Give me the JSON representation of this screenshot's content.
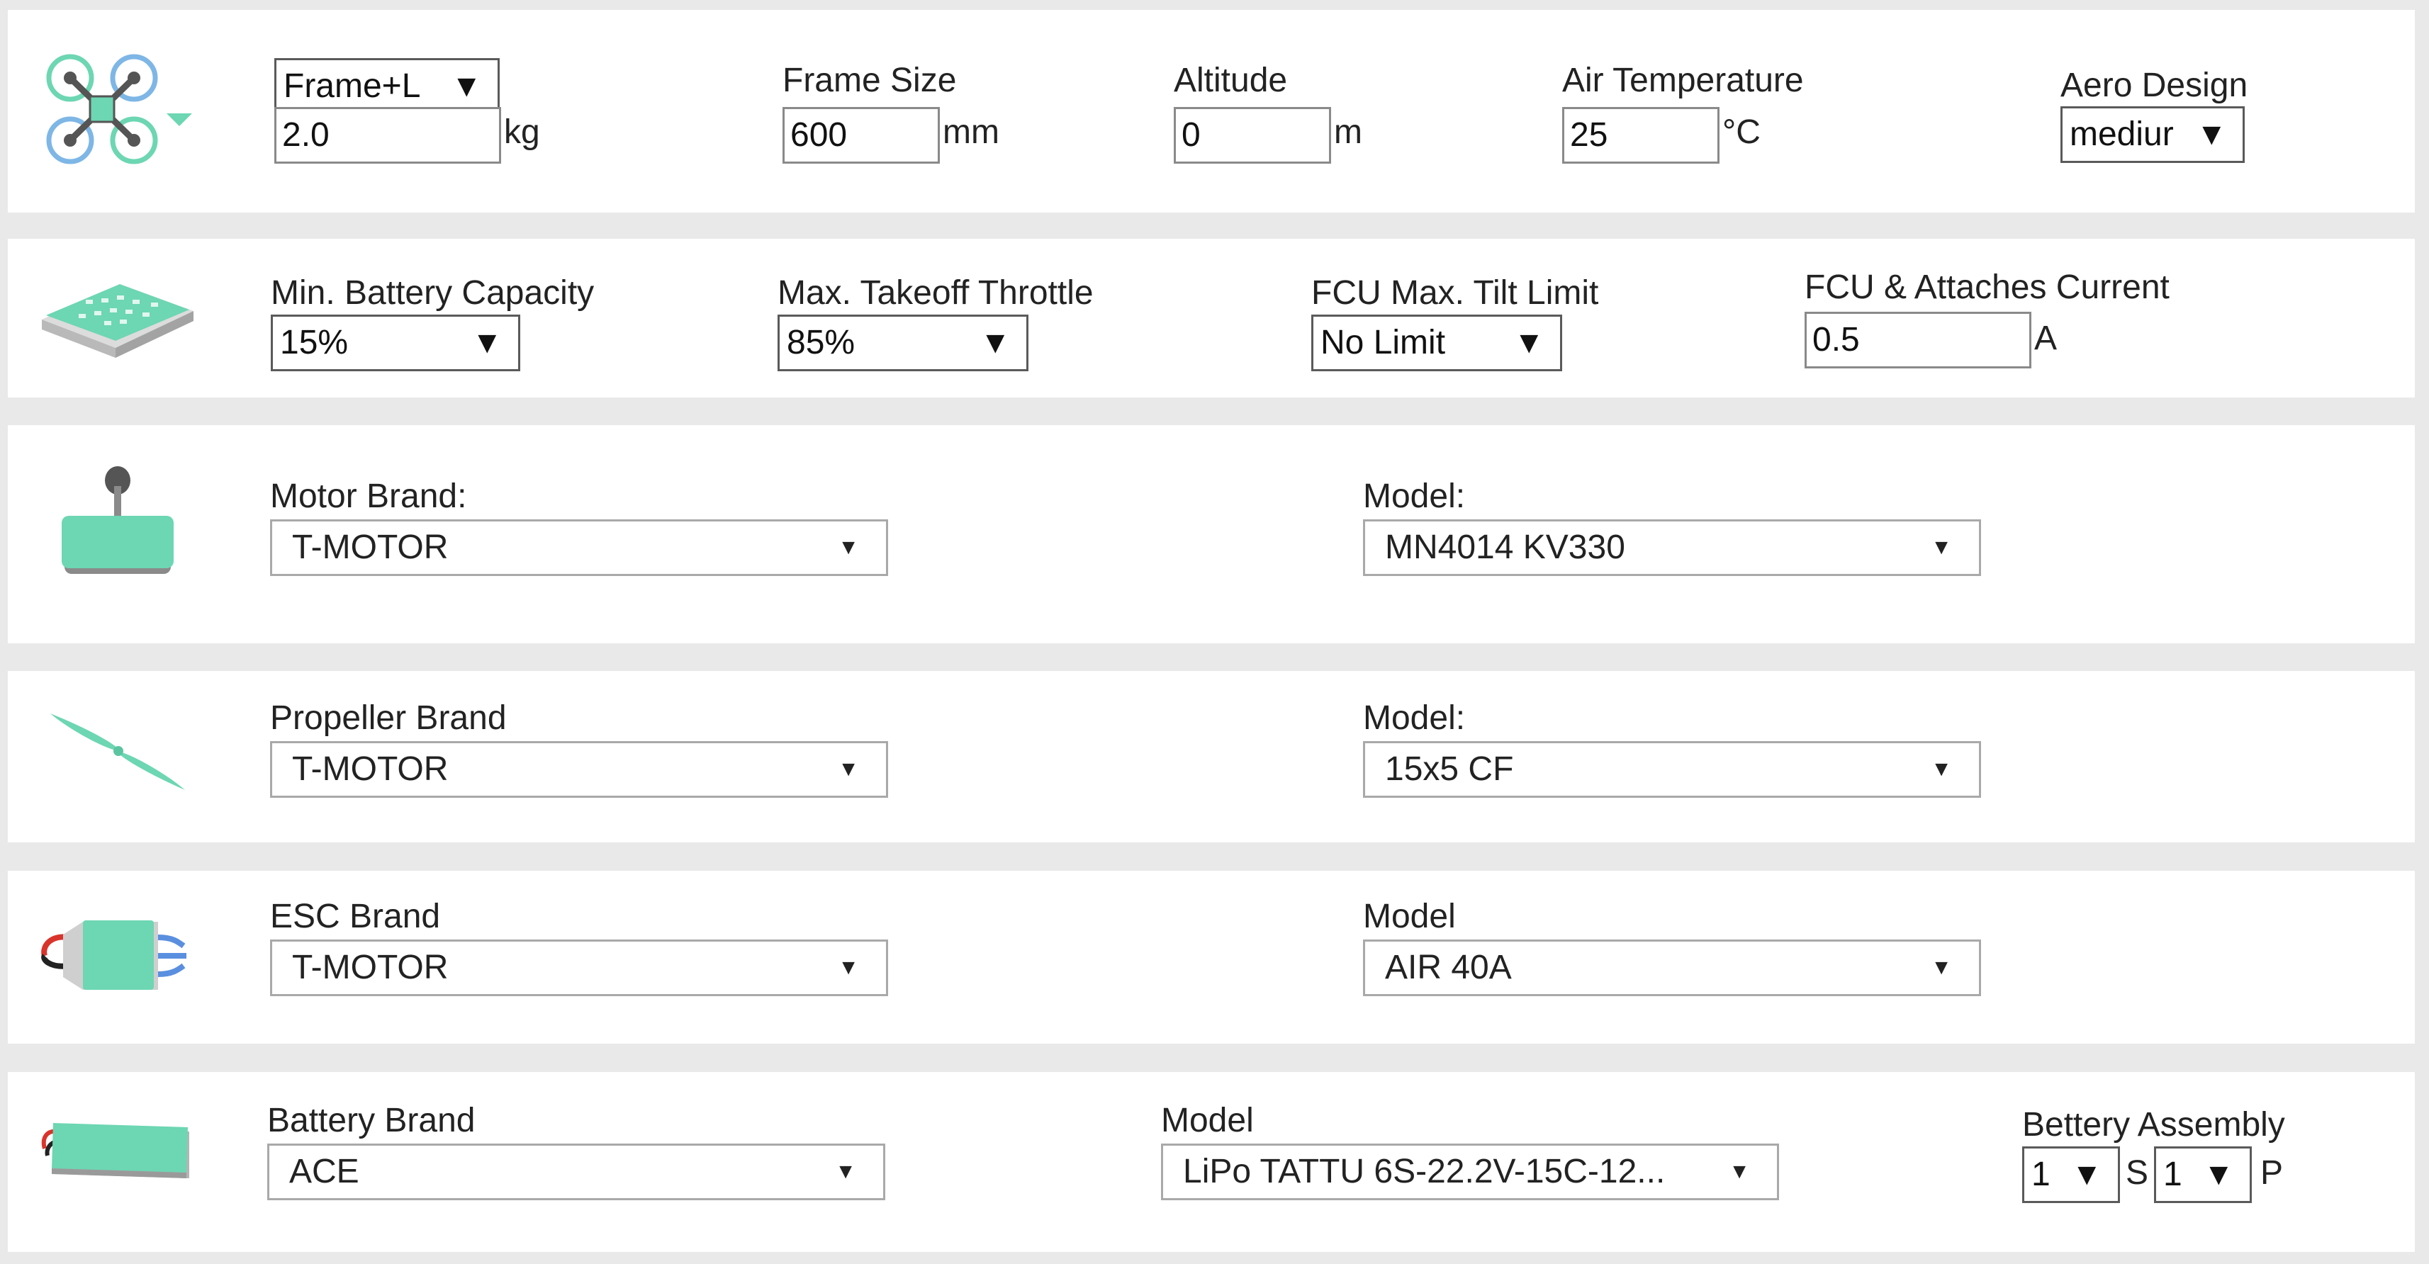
{
  "frame": {
    "icon": "quadcopter-frame-icon",
    "type_select": "Frame+L",
    "weight_value": "2.0",
    "weight_unit": "kg",
    "frame_size_label": "Frame Size",
    "frame_size_value": "600",
    "frame_size_unit": "mm",
    "altitude_label": "Altitude",
    "altitude_value": "0",
    "altitude_unit": "m",
    "air_temp_label": "Air Temperature",
    "air_temp_value": "25",
    "air_temp_unit": "°C",
    "aero_label": "Aero Design",
    "aero_select": "mediur"
  },
  "controller": {
    "icon": "flight-controller-icon",
    "min_battery_label": "Min. Battery Capacity",
    "min_battery_select": "15%",
    "max_throttle_label": "Max. Takeoff Throttle",
    "max_throttle_select": "85%",
    "tilt_label": "FCU Max. Tilt Limit",
    "tilt_select": "No Limit",
    "current_label": "FCU & Attaches Current",
    "current_value": "0.5",
    "current_unit": "A"
  },
  "motor": {
    "icon": "motor-icon",
    "brand_label": "Motor Brand:",
    "brand_select": "T-MOTOR",
    "model_label": "Model:",
    "model_select": "MN4014 KV330"
  },
  "propeller": {
    "icon": "propeller-icon",
    "brand_label": "Propeller Brand",
    "brand_select": "T-MOTOR",
    "model_label": "Model:",
    "model_select": "15x5 CF"
  },
  "esc": {
    "icon": "esc-icon",
    "brand_label": "ESC Brand",
    "brand_select": "T-MOTOR",
    "model_label": "Model",
    "model_select": "AIR 40A"
  },
  "battery": {
    "icon": "battery-icon",
    "brand_label": "Battery Brand",
    "brand_select": "ACE",
    "model_label": "Model",
    "model_select": "LiPo TATTU 6S-22.2V-15C-12...",
    "assembly_label": "Bettery Assembly",
    "series_select": "1",
    "series_unit": "S",
    "parallel_select": "1",
    "parallel_unit": "P"
  },
  "colors": {
    "accent": "#6dd6b3",
    "page_bg": "#e9e9e9",
    "panel_bg": "#ffffff"
  }
}
